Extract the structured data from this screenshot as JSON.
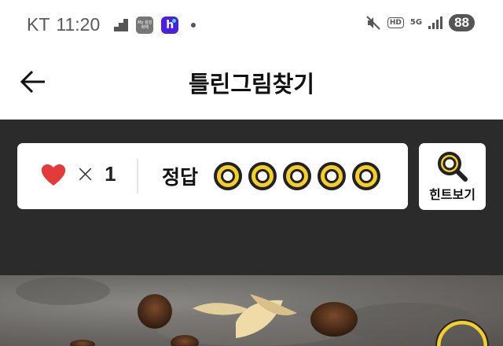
{
  "status_bar": {
    "carrier": "KT",
    "time": "11:20",
    "samsung_badge": "My 삼성화재",
    "h_badge": "h",
    "battery": "88",
    "hd_label": "HD",
    "network_label": "5G"
  },
  "header": {
    "title": "틀린그림찾기"
  },
  "game": {
    "lives_prefix": "×",
    "lives_count": "1",
    "answer_label": "정답",
    "answer_slots": 5,
    "hint_label": "힌트보기"
  },
  "colors": {
    "accent_yellow": "#f4cf2b",
    "heart_red": "#e33a3a",
    "panel_dark": "#2b2b2b"
  }
}
